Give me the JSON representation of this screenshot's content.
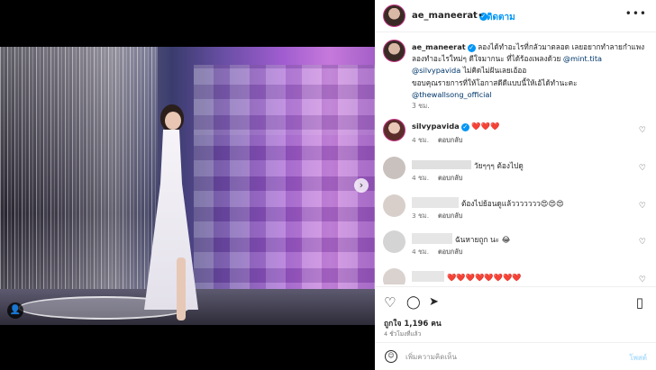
{
  "header": {
    "username": "ae_maneerat",
    "verified_icon": "✓",
    "dot": "•",
    "follow_label": "ติดตาม",
    "more_icon": "•••"
  },
  "caption": {
    "username": "ae_maneerat",
    "text1": " ลองได้ทำอะไรที่กลัวมาตลอด เลยอยากทำลายกำแพง ลองทำอะไรใหม่ๆ ดีใจมากนะ ที่ได้ร้องเพลงด้วย ",
    "mention1": "@mint.tita",
    "mention2": "@silvypavida",
    "text2": " ไม่คิดไม่ฝันเลยเอ้ออ",
    "text3": "ขอบคุณรายการที่ให้โอกาสดีดีแบบนี้ให้เอ้ได้ทำนะคะ",
    "mention3": "@thewallsong_official",
    "time": "3 ชม."
  },
  "comments": [
    {
      "username": "silvypavida",
      "text": "❤️❤️❤️",
      "time": "4 ชม.",
      "reply": "ตอบกลับ"
    },
    {
      "username": "",
      "text": "วัยๆๆๆ ต้องไปดู",
      "time": "4 ชม.",
      "reply": "ตอบกลับ"
    },
    {
      "username": "",
      "text": "ต้องไปย้อนดูแล้ววววววว😍😍😍",
      "time": "3 ชม.",
      "reply": "ตอบกลับ"
    },
    {
      "username": "",
      "text": "ฉันหายถูก นะ 😂",
      "time": "4 ชม.",
      "reply": "ตอบกลับ"
    },
    {
      "username": "",
      "text": "❤️❤️❤️❤️❤️❤️❤️❤️",
      "time": "",
      "reply": ""
    }
  ],
  "actions": {
    "like_icon": "♡",
    "comment_icon": "◯",
    "share_icon": "➤",
    "save_icon": "▯"
  },
  "likes": "ถูกใจ 1,196 คน",
  "posted_ago": "4 ชั่วโมงที่แล้ว",
  "add_comment": {
    "placeholder": "เพิ่มความคิดเห็น",
    "post_label": "โพสต์"
  },
  "media": {
    "next_icon": "›",
    "user_tag_icon": "👤"
  }
}
